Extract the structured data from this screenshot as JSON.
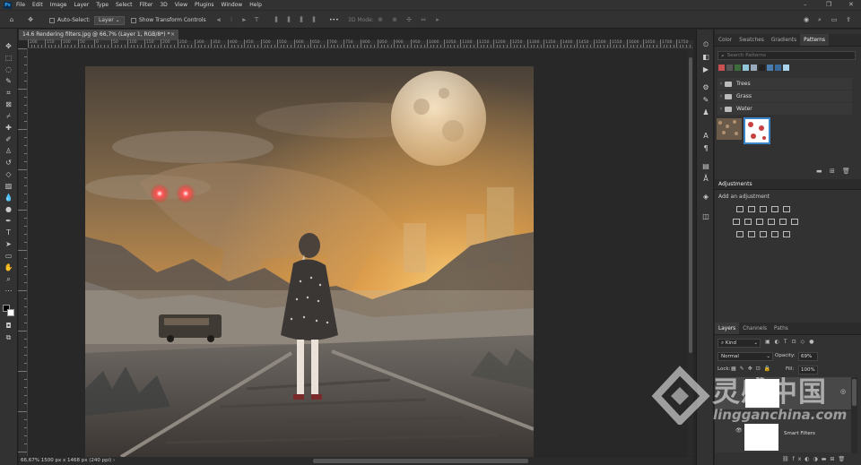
{
  "app": {
    "logo": "Ps"
  },
  "menu": [
    "File",
    "Edit",
    "Image",
    "Layer",
    "Type",
    "Select",
    "Filter",
    "3D",
    "View",
    "Plugins",
    "Window",
    "Help"
  ],
  "window_controls": [
    "–",
    "❐",
    "✕"
  ],
  "options_bar": {
    "auto_select_label": "Auto-Select:",
    "auto_select_value": "Layer",
    "transform_label": "Show Transform Controls",
    "more": "•••",
    "mode_3d": "3D Mode:"
  },
  "document": {
    "tab_title": "14.6 Rendering filters.jpg @ 66,7% (Layer 1, RGB/8*) *",
    "close": "×"
  },
  "ruler_labels": [
    "200",
    "150",
    "100",
    "50",
    "0",
    "50",
    "100",
    "150",
    "200",
    "250",
    "300",
    "350",
    "400",
    "450",
    "500",
    "550",
    "600",
    "650",
    "700",
    "750",
    "800",
    "850",
    "900",
    "950",
    "1000",
    "1050",
    "1100",
    "1150",
    "1200",
    "1250",
    "1300",
    "1350",
    "1400",
    "1450",
    "1500",
    "1550",
    "1600",
    "1650",
    "1700",
    "1750"
  ],
  "status": {
    "text": "66,67%   1500 px x 1468 px (240 ppi)   ›"
  },
  "panels": {
    "top_tabs": [
      "Color",
      "Swatches",
      "Gradients",
      "Patterns"
    ],
    "active_top_tab": "Patterns",
    "search_placeholder": "Search Patterns",
    "pattern_folders": [
      "Trees",
      "Grass",
      "Water"
    ],
    "adjustments_title": "Adjustments",
    "adjustments_hint": "Add an adjustment",
    "layer_tabs": [
      "Layers",
      "Channels",
      "Paths"
    ],
    "kind_value": "Kind",
    "blend_mode": "Normal",
    "opacity_label": "Opacity:",
    "opacity_value": "69%",
    "lock_label": "Lock:",
    "fill_label": "Fill:",
    "fill_value": "100%",
    "smart_filters_label": "Smart Filters"
  },
  "watermark": {
    "brand_cn": "灵感中国",
    "brand_url": "lingganchina.com"
  },
  "colors": {
    "accent": "#31a8ff",
    "panel_bg": "#323232",
    "canvas_bg": "#282828"
  }
}
